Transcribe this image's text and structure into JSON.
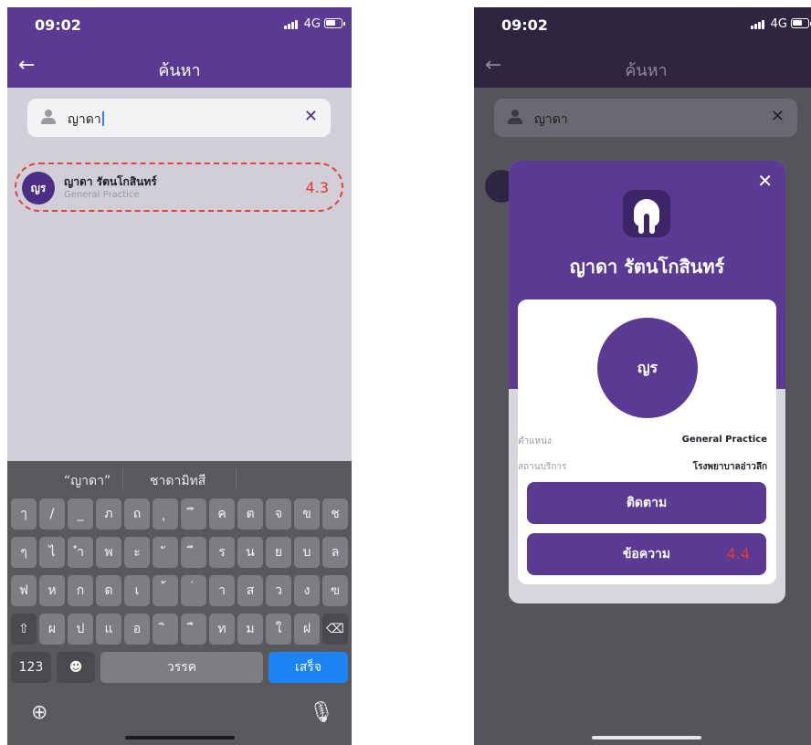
{
  "left_screen": {
    "status": {
      "time": "09:02",
      "network": "4G"
    },
    "nav": {
      "back_icon": "arrow-left-icon",
      "title": "ค้นหา"
    },
    "search": {
      "value": "ญาดา",
      "clear_icon": "close-icon",
      "person_icon": "person-icon"
    },
    "result": {
      "avatar_initials": "ญร",
      "name": "ญาดา รัตนโกสินทร์",
      "specialty": "General Practice",
      "annotation": "4.3",
      "highlight_color": "#e0463a"
    },
    "keyboard": {
      "suggestions": [
        "“ญาดา”",
        "ชาดามิทสี"
      ],
      "rows": [
        [
          "ๅ",
          "/",
          "_",
          "ภ",
          "ถ",
          "ุ",
          "ึ",
          "ค",
          "ต",
          "จ",
          "ข",
          "ช"
        ],
        [
          "ๆ",
          "ไ",
          "ำ",
          "พ",
          "ะ",
          "ั",
          "ี",
          "ร",
          "น",
          "ย",
          "บ",
          "ล"
        ],
        [
          "ฟ",
          "ห",
          "ก",
          "ด",
          "เ",
          "้",
          "่",
          "า",
          "ส",
          "ว",
          "ง",
          "ฃ"
        ],
        [
          "⇧",
          "ผ",
          "ป",
          "แ",
          "อ",
          "ิ",
          "ื",
          "ท",
          "ม",
          "ใ",
          "ฝ",
          "⌫"
        ]
      ],
      "numbers_key": "123",
      "emoji_key": "☻",
      "space_key": "วรรค",
      "done_key": "เสร็จ",
      "globe_icon": "globe-icon",
      "mic_icon": "microphone-icon"
    }
  },
  "right_screen": {
    "status": {
      "time": "09:02",
      "network": "4G"
    },
    "nav": {
      "title": "ค้นหา"
    },
    "search": {
      "value": "ญาดา"
    },
    "modal": {
      "close_icon": "close-icon",
      "logo_icon": "tooth-icon",
      "name": "ญาดา รัตนโกสินทร์",
      "avatar_initials": "ญร",
      "position_label": "ตำแหน่ง",
      "position_value": "General Practice",
      "facility_label": "สถานบริการ",
      "facility_value": "โรงพยาบาลอ่าวลึก",
      "follow_button": "ติดตาม",
      "message_button": "ข้อความ",
      "annotation": "4.4"
    }
  },
  "colors": {
    "brand_purple": "#5a3a93",
    "keyboard_done": "#1c84f5",
    "annotation_red": "#e53b2c"
  }
}
